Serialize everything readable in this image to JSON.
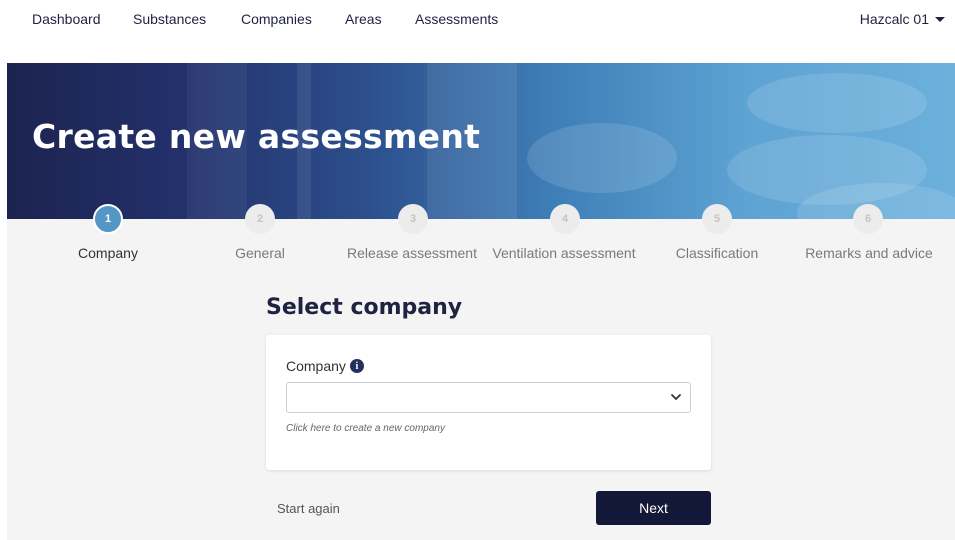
{
  "nav": {
    "items": [
      "Dashboard",
      "Substances",
      "Companies",
      "Areas",
      "Assessments"
    ],
    "user": "Hazcalc 01"
  },
  "hero": {
    "title": "Create new assessment"
  },
  "steps": [
    {
      "num": "1",
      "label": "Company",
      "active": true
    },
    {
      "num": "2",
      "label": "General",
      "active": false
    },
    {
      "num": "3",
      "label": "Release assessment",
      "active": false
    },
    {
      "num": "4",
      "label": "Ventilation assessment",
      "active": false
    },
    {
      "num": "5",
      "label": "Classification",
      "active": false
    },
    {
      "num": "6",
      "label": "Remarks and advice",
      "active": false
    }
  ],
  "form": {
    "title": "Select company",
    "company_label": "Company",
    "company_value": "",
    "info_icon": "i",
    "create_hint": "Click here to create a new company"
  },
  "actions": {
    "start_again": "Start again",
    "next": "Next"
  },
  "colors": {
    "accent": "#5496c6",
    "primary_dark": "#141838"
  }
}
